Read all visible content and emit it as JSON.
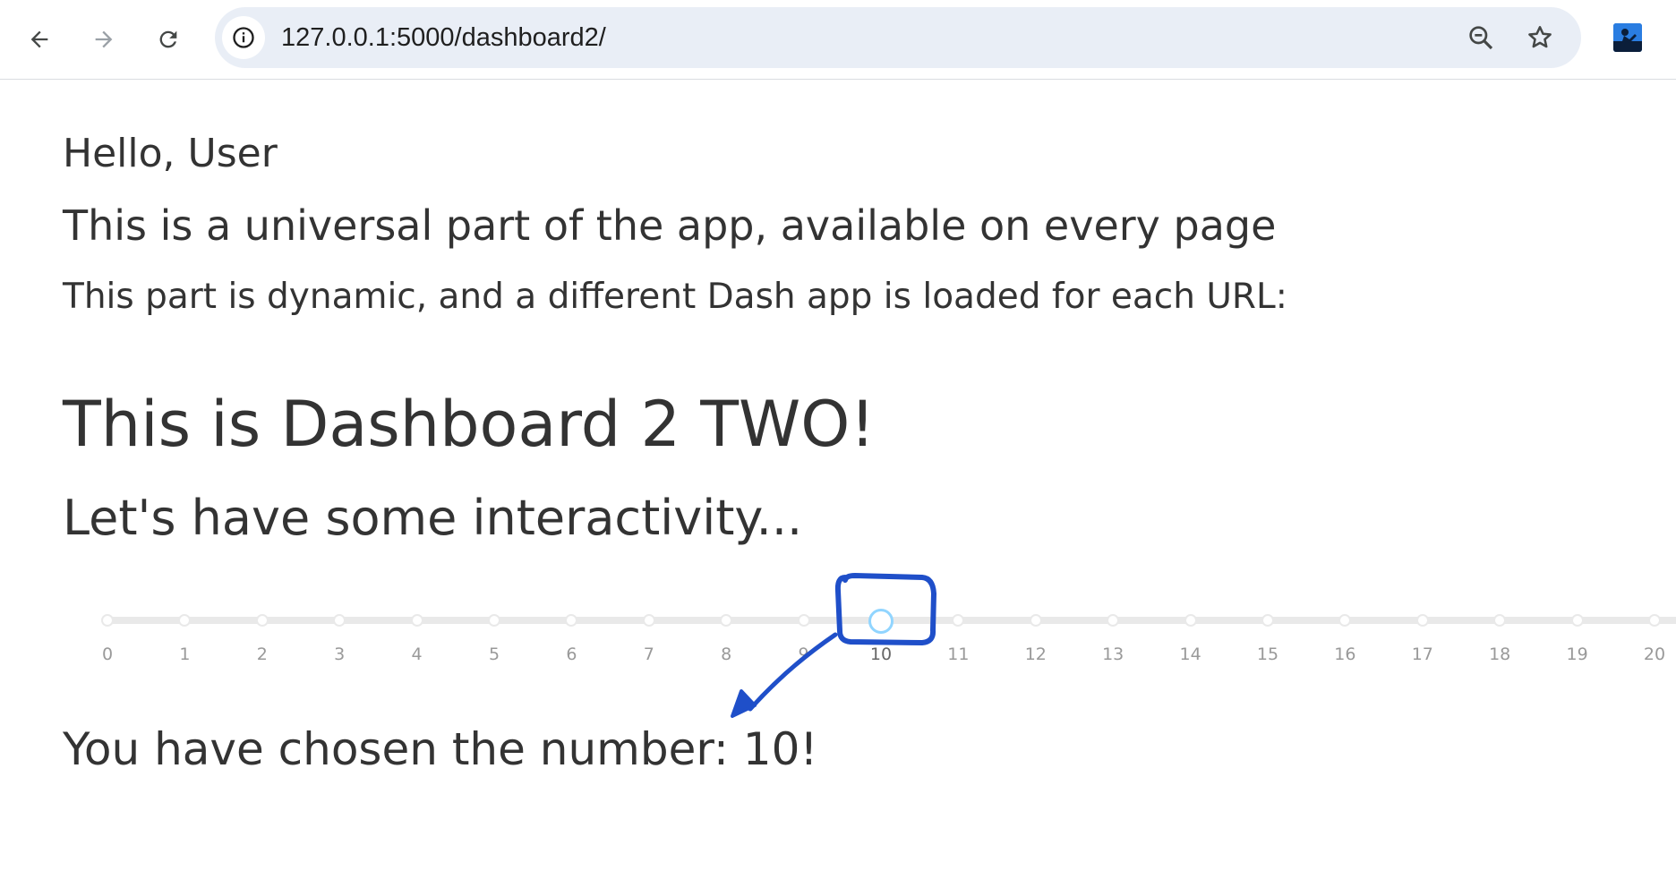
{
  "browser": {
    "url": "127.0.0.1:5000/dashboard2/",
    "icons": {
      "back": "arrow-left-icon",
      "forward": "arrow-right-icon",
      "reload": "reload-icon",
      "site_info": "info-icon",
      "zoom": "zoom-icon",
      "bookmark": "star-icon",
      "profile": "profile-avatar"
    }
  },
  "header": {
    "greeting": "Hello, User",
    "universal_text": "This is a universal part of the app, available on every page",
    "dynamic_text": "This part is dynamic, and a different Dash app is loaded for each URL:"
  },
  "dashboard": {
    "title": "This is Dashboard 2 TWO!",
    "subtitle": "Let's have some interactivity...",
    "slider": {
      "min": 0,
      "max": 20,
      "value": 10,
      "marks": [
        "0",
        "1",
        "2",
        "3",
        "4",
        "5",
        "6",
        "7",
        "8",
        "9",
        "10",
        "11",
        "12",
        "13",
        "14",
        "15",
        "16",
        "17",
        "18",
        "19",
        "20"
      ]
    },
    "result_text": "You have chosen the number: 10!"
  },
  "colors": {
    "text": "#333333",
    "rail": "#e9e9e9",
    "handle_border": "#91d5ff",
    "annotation": "#1f4fc9",
    "omnibox": "#e9eef6"
  }
}
